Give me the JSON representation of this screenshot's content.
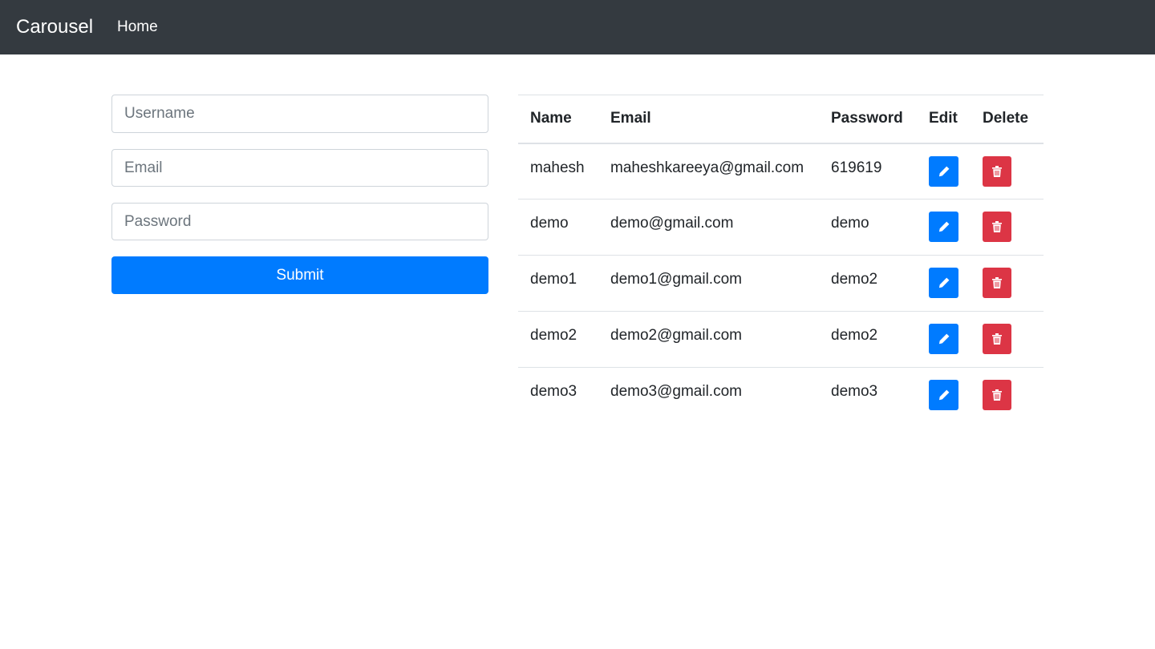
{
  "navbar": {
    "brand": "Carousel",
    "home_link": "Home"
  },
  "form": {
    "username_placeholder": "Username",
    "email_placeholder": "Email",
    "password_placeholder": "Password",
    "submit_label": "Submit"
  },
  "table": {
    "headers": {
      "name": "Name",
      "email": "Email",
      "password": "Password",
      "edit": "Edit",
      "delete": "Delete"
    },
    "rows": [
      {
        "name": "mahesh",
        "email": "maheshkareeya@gmail.com",
        "password": "619619"
      },
      {
        "name": "demo",
        "email": "demo@gmail.com",
        "password": "demo"
      },
      {
        "name": "demo1",
        "email": "demo1@gmail.com",
        "password": "demo2"
      },
      {
        "name": "demo2",
        "email": "demo2@gmail.com",
        "password": "demo2"
      },
      {
        "name": "demo3",
        "email": "demo3@gmail.com",
        "password": "demo3"
      }
    ]
  },
  "icons": {
    "edit": "pencil-icon",
    "delete": "trash-icon"
  },
  "colors": {
    "navbar": "#343a40",
    "primary": "#007bff",
    "danger": "#dc3545"
  }
}
